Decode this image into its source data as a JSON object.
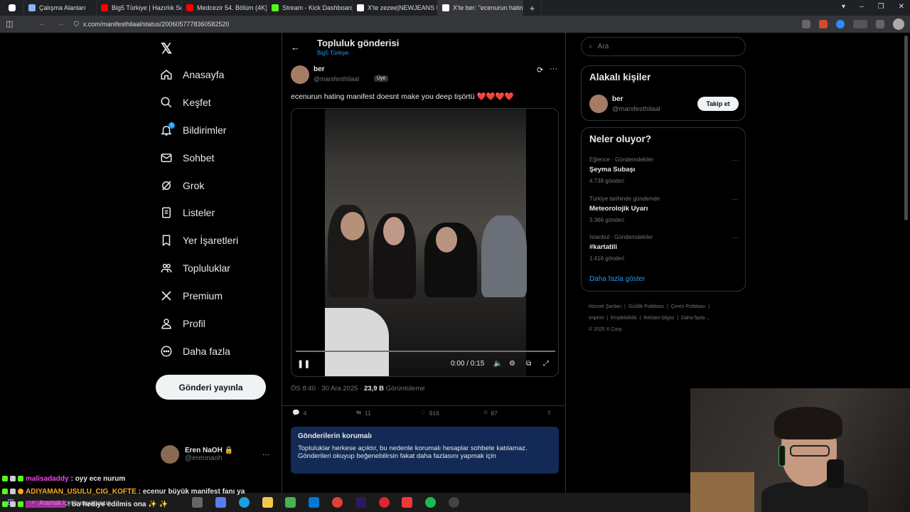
{
  "browser": {
    "tabs": [
      {
        "label": "Çalışma Alanları",
        "color": "#8ab4f8"
      },
      {
        "label": "Big5 Türkiye | Hazırlık Sezo",
        "color": "#ff0000"
      },
      {
        "label": "Medcezir 54. Bölüm (4K) - Y",
        "color": "#ff0000"
      },
      {
        "label": "Stream - Kick Dashboard",
        "color": "#53fc18"
      },
      {
        "label": "X'te zezee|NEWJEANS IS FI",
        "color": "#ffffff"
      },
      {
        "label": "X'te ber: \"ecenurun hating",
        "color": "#ffffff"
      }
    ],
    "url": "x.com/manifesthilaal/status/2006057778360582520"
  },
  "nav": {
    "items": [
      {
        "label": "Anasayfa",
        "icon": "home-icon"
      },
      {
        "label": "Keşfet",
        "icon": "search-icon"
      },
      {
        "label": "Bildirimler",
        "icon": "bell-icon",
        "badge": "1"
      },
      {
        "label": "Sohbet",
        "icon": "mail-icon"
      },
      {
        "label": "Grok",
        "icon": "grok-icon"
      },
      {
        "label": "Listeler",
        "icon": "list-icon"
      },
      {
        "label": "Yer İşaretleri",
        "icon": "bookmark-icon"
      },
      {
        "label": "Topluluklar",
        "icon": "communities-icon"
      },
      {
        "label": "Premium",
        "icon": "x-icon"
      },
      {
        "label": "Profil",
        "icon": "person-icon"
      },
      {
        "label": "Daha fazla",
        "icon": "more-circle-icon"
      }
    ],
    "post_button": "Gönderi yayınla",
    "account": {
      "name": "Eren NaOH",
      "handle": "@erennaoh"
    }
  },
  "post": {
    "header_title": "Topluluk gönderisi",
    "header_sub": "Big5 Türkiye",
    "author_name": "ber",
    "author_handle": "@manifesthilaal",
    "badge": "Üye",
    "text": "ecenurun hating manifest doesnt make you deep tişörtü",
    "hearts": "❤️❤️❤️❤️",
    "video_time": "0:00 / 0:15",
    "timestamp": "ÖS 8:40 · 30 Ara 2025 · ",
    "views": "23,9 B",
    "views_label": " Görüntüleme",
    "replies": "4",
    "reposts": "11",
    "likes": "916",
    "bookmarks": "87",
    "notice_title": "Gönderilerin korumalı",
    "notice_body": "Topluluklar herkese açıktır, bu nedenle korumalı hesaplar sohbete katılamaz. Gönderileri okuyup beğenebilirsin fakat daha fazlasını yapmak için"
  },
  "right": {
    "search_placeholder": "Ara",
    "related_title": "Alakalı kişiler",
    "related_name": "ber",
    "related_handle": "@manifesthilaal",
    "follow_label": "Takip et",
    "trends_title": "Neler oluyor?",
    "trends": [
      {
        "category": "Eğlence · Gündemdekiler",
        "name": "Şeyma Subaşı",
        "count": "4.738 gönderi"
      },
      {
        "category": "Türkiye tarihinde gündemde",
        "name": "Meteorolojik Uyarı",
        "count": "3.366 gönderi"
      },
      {
        "category": "İstanbul · Gündemdekiler",
        "name": "#kartatili",
        "count": "1.416 gönderi"
      }
    ],
    "show_more": "Daha fazla göster",
    "footer": [
      "Hizmet Şartları",
      "Gizlilik Politikası",
      "Çerez Politikası",
      "Imprint",
      "Erişilebilirlik",
      "Reklam bilgisi",
      "Daha fazla ...",
      "© 2025 X Corp."
    ]
  },
  "chat": [
    {
      "user": "malisadaddy",
      "color": "#ff3df2",
      "msg": ": oyy ece nurum"
    },
    {
      "user": "ADIYAMAN_USULU_CIG_KOFTE",
      "color": "#ffb020",
      "msg": ": ecenur büyük manifest fanı ya"
    },
    {
      "user": "",
      "color": "#ff3df2",
      "msg": ": bu hediye edilmis ona ✨ ✨"
    }
  ],
  "taskbar": {
    "search_placeholder": "Aramak için buraya yazın"
  }
}
